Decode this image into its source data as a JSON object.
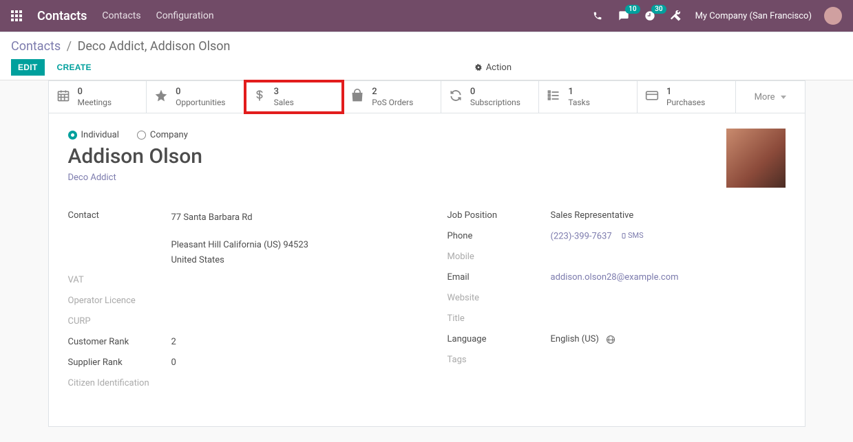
{
  "navbar": {
    "brand": "Contacts",
    "links": [
      "Contacts",
      "Configuration"
    ],
    "chat_count": "10",
    "activity_count": "30",
    "company": "My Company (San Francisco)"
  },
  "breadcrumb": {
    "root": "Contacts",
    "page": "Deco Addict, Addison Olson"
  },
  "buttons": {
    "edit": "EDIT",
    "create": "CREATE",
    "action": "Action"
  },
  "stats": {
    "meetings": {
      "count": "0",
      "label": "Meetings"
    },
    "opportunities": {
      "count": "0",
      "label": "Opportunities"
    },
    "sales": {
      "count": "3",
      "label": "Sales"
    },
    "pos_orders": {
      "count": "2",
      "label": "PoS Orders"
    },
    "subscriptions": {
      "count": "0",
      "label": "Subscriptions"
    },
    "tasks": {
      "count": "1",
      "label": "Tasks"
    },
    "purchases": {
      "count": "1",
      "label": "Purchases"
    },
    "more": "More"
  },
  "contact": {
    "type_individual": "Individual",
    "type_company": "Company",
    "name": "Addison Olson",
    "parent_company": "Deco Addict",
    "left": {
      "contact_label": "Contact",
      "street": "77 Santa Barbara Rd",
      "city_line": "Pleasant Hill  California (US)  94523",
      "country": "United States",
      "vat_label": "VAT",
      "operator_licence_label": "Operator Licence",
      "curp_label": "CURP",
      "customer_rank_label": "Customer Rank",
      "customer_rank": "2",
      "supplier_rank_label": "Supplier Rank",
      "supplier_rank": "0",
      "citizen_id_label": "Citizen Identification"
    },
    "right": {
      "job_position_label": "Job Position",
      "job_position": "Sales Representative",
      "phone_label": "Phone",
      "phone": "(223)-399-7637",
      "sms": "SMS",
      "mobile_label": "Mobile",
      "email_label": "Email",
      "email": "addison.olson28@example.com",
      "website_label": "Website",
      "title_label": "Title",
      "language_label": "Language",
      "language": "English (US)",
      "tags_label": "Tags"
    }
  }
}
